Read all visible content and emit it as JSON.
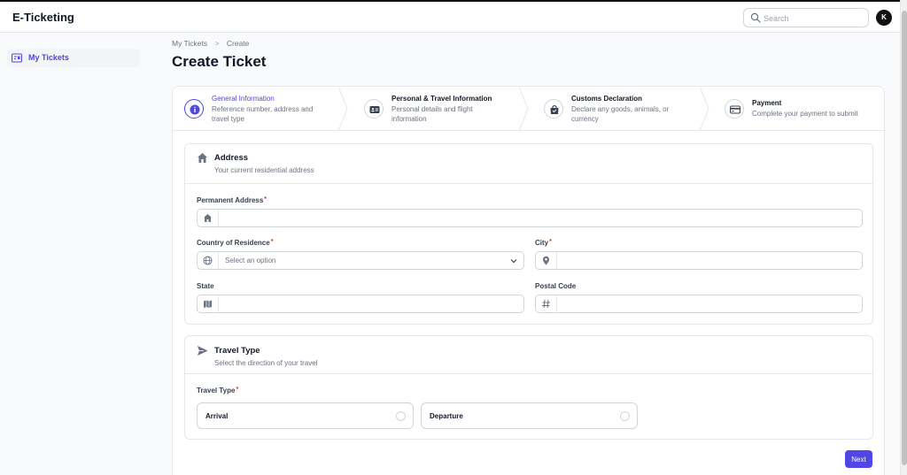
{
  "app": {
    "title": "E-Ticketing",
    "accent": "#4f46e5"
  },
  "header": {
    "search_placeholder": "Search",
    "avatar_initial": "K"
  },
  "sidebar": {
    "items": [
      {
        "label": "My Tickets",
        "icon": "ticket-icon",
        "active": true
      }
    ]
  },
  "breadcrumb": {
    "items": [
      "My Tickets",
      "Create"
    ],
    "separator": ">"
  },
  "page": {
    "title": "Create Ticket"
  },
  "wizard": {
    "steps": [
      {
        "title": "General Information",
        "description": "Reference number, address and travel type",
        "icon": "info-icon",
        "active": true
      },
      {
        "title": "Personal & Travel Information",
        "description": "Personal details and flight information",
        "icon": "id-card-icon",
        "active": false
      },
      {
        "title": "Customs Declaration",
        "description": "Declare any goods, animals, or currency",
        "icon": "bag-icon",
        "active": false
      },
      {
        "title": "Payment",
        "description": "Complete your payment to submit",
        "icon": "credit-card-icon",
        "active": false
      }
    ]
  },
  "address": {
    "title": "Address",
    "subtitle": "Your current residential address",
    "icon": "home-icon",
    "fields": {
      "permanent_address": {
        "label": "Permanent Address",
        "required": "*",
        "value": "",
        "icon": "home-icon"
      },
      "country": {
        "label": "Country of Residence",
        "required": "*",
        "placeholder": "Select an option",
        "icon": "globe-icon"
      },
      "city": {
        "label": "City",
        "required": "*",
        "value": "",
        "icon": "map-pin-icon"
      },
      "state": {
        "label": "State",
        "value": "",
        "icon": "map-icon"
      },
      "postal_code": {
        "label": "Postal Code",
        "value": "",
        "icon": "hash-icon"
      }
    }
  },
  "travel": {
    "title": "Travel Type",
    "subtitle": "Select the direction of your travel",
    "icon": "paper-plane-icon",
    "field_label": "Travel Type",
    "required": "*",
    "options": [
      "Arrival",
      "Departure"
    ]
  },
  "actions": {
    "next_label": "Next"
  }
}
